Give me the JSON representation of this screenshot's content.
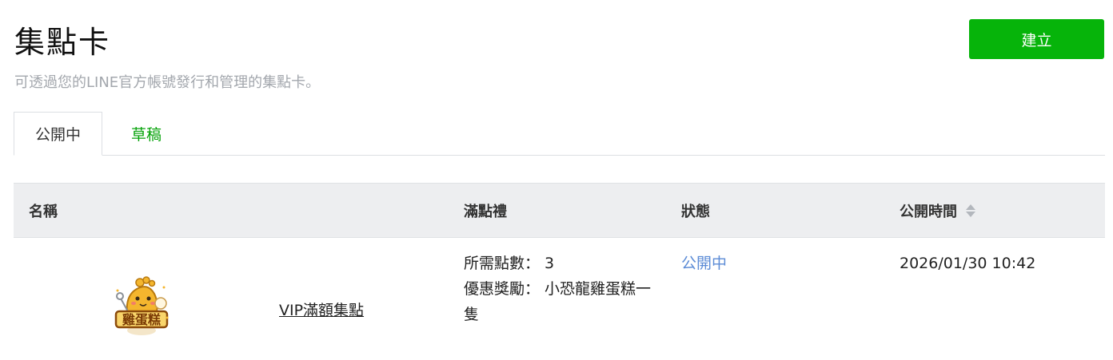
{
  "header": {
    "title": "集點卡",
    "subtitle": "可透過您的LINE官方帳號發行和管理的集點卡。",
    "create_label": "建立"
  },
  "tabs": [
    {
      "label": "公開中",
      "active": true
    },
    {
      "label": "草稿",
      "active": false
    }
  ],
  "table": {
    "columns": [
      "名稱",
      "滿點禮",
      "狀態",
      "公開時間"
    ],
    "rows": [
      {
        "thumbnail_icon": "dinosaur-egg-cake-icon",
        "thumbnail_text": "雞蛋糕",
        "name": "VIP滿額集點",
        "required_points": "所需點數： 3",
        "reward": "優惠獎勵： 小恐龍雞蛋糕一隻",
        "status": "公開中",
        "published_at": "2026/01/30 10:42"
      }
    ]
  },
  "colors": {
    "primary_green": "#06b40a",
    "tab_green": "#06a30a",
    "status_blue": "#5b8bd6",
    "header_bg": "#edeef0"
  }
}
